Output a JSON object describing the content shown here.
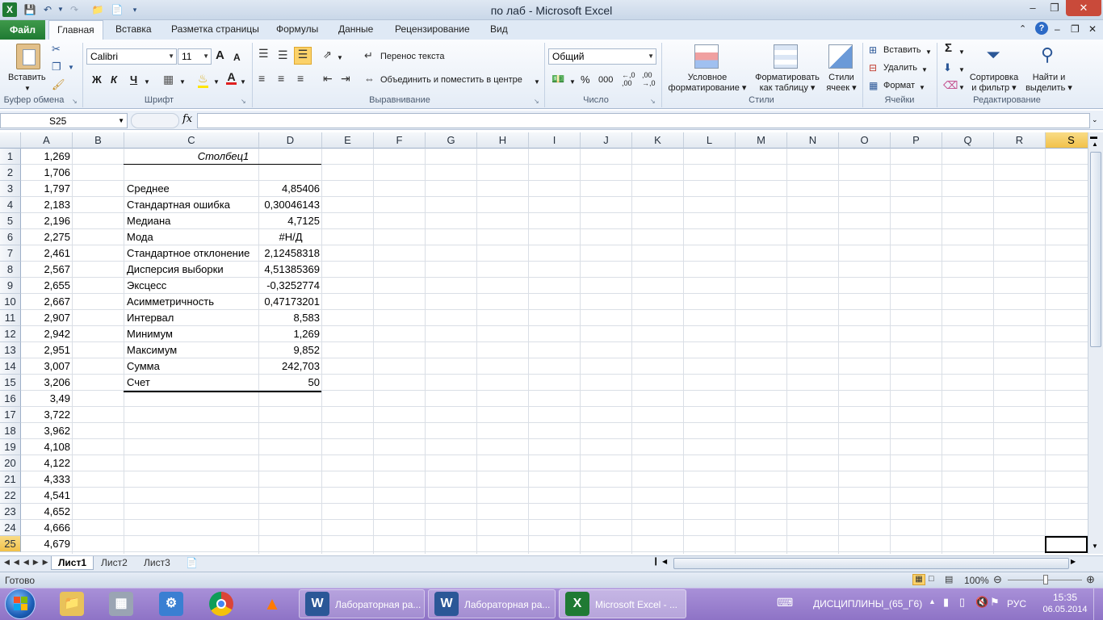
{
  "window": {
    "title": "по лаб  -  Microsoft Excel"
  },
  "qat": {
    "app_icon": "excel-icon",
    "save_icon": "save-icon",
    "undo_icon": "undo-icon",
    "redo_icon": "redo-icon",
    "open_icon": "folder-icon",
    "new_icon": "new-document-icon"
  },
  "ribbon_tabs": [
    "Файл",
    "Главная",
    "Вставка",
    "Разметка страницы",
    "Формулы",
    "Данные",
    "Рецензирование",
    "Вид"
  ],
  "active_tab": "Главная",
  "clipboard": {
    "group": "Буфер обмена",
    "paste": "Вставить"
  },
  "font": {
    "group": "Шрифт",
    "name": "Calibri",
    "size": "11",
    "bold": "Ж",
    "italic": "К",
    "underline": "Ч",
    "grow": "A",
    "shrink": "A"
  },
  "alignment": {
    "group": "Выравнивание",
    "wrap_text": "Перенос текста",
    "merge_center": "Объединить и поместить в центре"
  },
  "number": {
    "group": "Число",
    "format": "Общий",
    "percent": "%",
    "thousands": "000",
    "inc_decimal": "←,0 ,00",
    "dec_decimal": ",00 →,0"
  },
  "styles": {
    "group": "Стили",
    "conditional": [
      "Условное",
      "форматирование"
    ],
    "as_table": [
      "Форматировать",
      "как таблицу"
    ],
    "cell_styles": [
      "Стили",
      "ячеек"
    ]
  },
  "cells": {
    "group": "Ячейки",
    "insert": "Вставить",
    "delete": "Удалить",
    "format": "Формат"
  },
  "editing": {
    "group": "Редактирование",
    "sum": "Σ",
    "sort": [
      "Сортировка",
      "и фильтр"
    ],
    "find": [
      "Найти и",
      "выделить"
    ]
  },
  "formula_bar": {
    "name_box": "S25",
    "fx": "fx",
    "formula": ""
  },
  "columns": [
    "A",
    "B",
    "C",
    "D",
    "E",
    "F",
    "G",
    "H",
    "I",
    "J",
    "K",
    "L",
    "M",
    "N",
    "O",
    "P",
    "Q",
    "R",
    "S"
  ],
  "selected_column": "S",
  "selected_row": "25",
  "rows": [
    "1",
    "2",
    "3",
    "4",
    "5",
    "6",
    "7",
    "8",
    "9",
    "10",
    "11",
    "12",
    "13",
    "14",
    "15",
    "16",
    "17",
    "18",
    "19",
    "20",
    "21",
    "22",
    "23",
    "24",
    "25"
  ],
  "column_a": [
    "1,269",
    "1,706",
    "1,797",
    "2,183",
    "2,196",
    "2,275",
    "2,461",
    "2,567",
    "2,655",
    "2,667",
    "2,907",
    "2,942",
    "2,951",
    "3,007",
    "3,206",
    "3,49",
    "3,722",
    "3,962",
    "4,108",
    "4,122",
    "4,333",
    "4,541",
    "4,652",
    "4,666",
    "4,679"
  ],
  "stats": {
    "header": "Столбец1",
    "labels": [
      "Среднее",
      "Стандартная ошибка",
      "Медиана",
      "Мода",
      "Стандартное отклонение",
      "Дисперсия выборки",
      "Эксцесс",
      "Асимметричность",
      "Интервал",
      "Минимум",
      "Максимум",
      "Сумма",
      "Счет"
    ],
    "values": [
      "4,85406",
      "0,30046143",
      "4,7125",
      "#Н/Д",
      "2,12458318",
      "4,51385369",
      "-0,3252774",
      "0,47173201",
      "8,583",
      "1,269",
      "9,852",
      "242,703",
      "50"
    ]
  },
  "sheets": [
    "Лист1",
    "Лист2",
    "Лист3"
  ],
  "active_sheet": "Лист1",
  "status": {
    "ready": "Готово",
    "zoom": "100%"
  },
  "taskbar": {
    "buttons": [
      "Лабораторная ра...",
      "Лабораторная ра...",
      "Microsoft Excel - ..."
    ],
    "tray_label": "ДИСЦИПЛИНЫ_(65_Г6)",
    "language": "РУС",
    "time": "15:35",
    "date": "06.05.2014"
  }
}
